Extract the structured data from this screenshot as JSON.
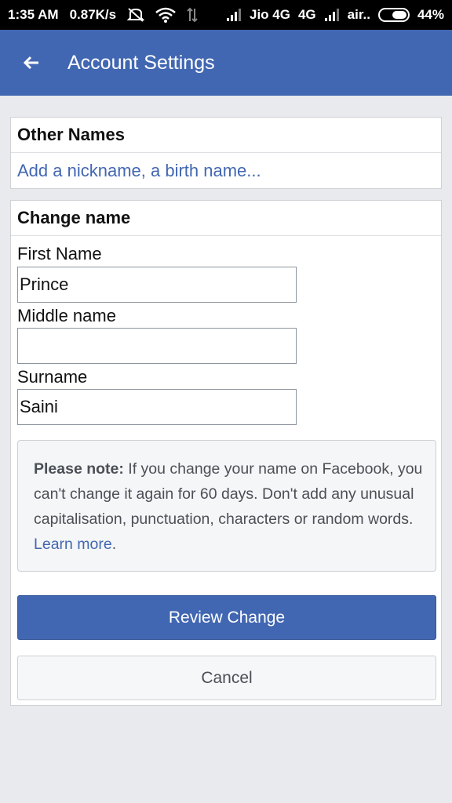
{
  "status_bar": {
    "time": "1:35 AM",
    "speed": "0.87K/s",
    "carrier1": "Jio 4G",
    "network1": "4G",
    "carrier2": "air..",
    "battery": "44%"
  },
  "app_bar": {
    "title": "Account Settings",
    "back_icon": "arrow-left-icon",
    "color": "#4267b2"
  },
  "other_names": {
    "heading": "Other Names",
    "link": "Add a nickname, a birth name..."
  },
  "change_name": {
    "heading": "Change name",
    "first_name_label": "First Name",
    "first_name_value": "Prince",
    "middle_name_label": "Middle name",
    "middle_name_value": "",
    "surname_label": "Surname",
    "surname_value": "Saini",
    "note_bold": "Please note:",
    "note_text": " If you change your name on Facebook, you can't change it again for 60 days. Don't add any unusual capitalisation, punctuation, characters or random words. ",
    "note_link": "Learn more",
    "note_end": ".",
    "review_button": "Review Change",
    "cancel_button": "Cancel"
  }
}
